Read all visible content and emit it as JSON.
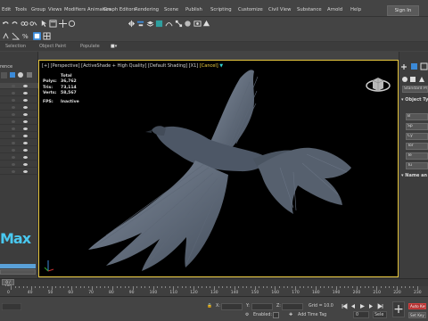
{
  "menu": {
    "items": [
      "Edit",
      "Tools",
      "Group",
      "Views",
      "Create",
      "Modifiers",
      "Animation",
      "Graph Editors",
      "Rendering",
      "Scene",
      "Publish",
      "Scripting",
      "Customize",
      "Civil View",
      "Substance",
      "Arnold",
      "Help"
    ],
    "signin_label": "Sign In"
  },
  "toolbar": {
    "selection_set_placeholder": "Create Selection Se"
  },
  "ribbon": {
    "tabs": [
      "Selection",
      "Object Paint",
      "Populate"
    ]
  },
  "scene_explorer": {
    "title": "rence",
    "logo_text": "Max",
    "layer_value": "0 / 100"
  },
  "viewport": {
    "label_prefix": "[+] [Perspective] [ActiveShade + High Quality] [Default Shading] [X1]",
    "label_cancel": "[Cancel]",
    "stats": {
      "header": "Total",
      "rows": [
        {
          "key": "Polys:",
          "value": "36,762"
        },
        {
          "key": "Tris:",
          "value": "73,114"
        },
        {
          "key": "Verts:",
          "value": "58,567"
        }
      ],
      "fps_key": "FPS:",
      "fps_value": "Inactive"
    }
  },
  "command_panel": {
    "dropdown": "Standard Prim",
    "header_object_type": "Object Ty",
    "buttons": [
      "B",
      "Sp",
      "Cy",
      "Tor",
      "Te",
      "Tu"
    ],
    "header_name": "Name an"
  },
  "timeline": {
    "slider_text": "0 / 100",
    "ticks": [
      "0",
      "40",
      "50",
      "60",
      "70",
      "80",
      "90",
      "100",
      "110",
      "120",
      "130",
      "140",
      "150",
      "160",
      "170",
      "180",
      "190",
      "200",
      "210",
      "220",
      "230"
    ]
  },
  "status": {
    "x_label": "X:",
    "y_label": "Y:",
    "z_label": "Z:",
    "x_value": "",
    "y_value": "",
    "z_value": "",
    "grid_label": "Grid = 10.0",
    "enabled_label": "Enabled:",
    "add_time_tag": "Add Time Tag",
    "auto_key": "Auto Key",
    "set_key": "Set Key",
    "frame_value": "0",
    "selected_value": "Sele"
  },
  "colors": {
    "accent_blue": "#3b8ad8",
    "viewport_border": "#e8c840",
    "auto_key_red": "#b03030",
    "logo_cyan": "#49c8f0"
  }
}
